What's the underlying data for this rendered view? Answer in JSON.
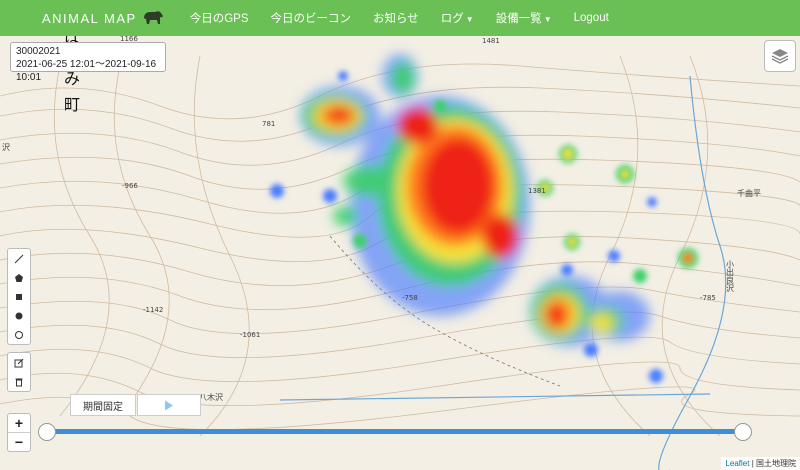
{
  "app": {
    "brand": "ANIMAL MAP"
  },
  "nav": {
    "items": [
      {
        "label": "今日のGPS"
      },
      {
        "label": "今日のビーコン"
      },
      {
        "label": "お知らせ"
      },
      {
        "label": "ログ",
        "dropdown": true
      },
      {
        "label": "設備一覧",
        "dropdown": true
      },
      {
        "label": "Logout"
      }
    ]
  },
  "info": {
    "device_id": "30002021",
    "period": "2021-06-25 12:01～2021-09-16 10:01"
  },
  "map_labels": {
    "town": [
      "は",
      "み",
      "町"
    ],
    "elevations": [
      "1166",
      "1481",
      "781",
      "-966",
      "1381",
      "-758",
      "-785",
      "-1142",
      "-1061"
    ],
    "places": [
      "千曲平",
      "小出良沢",
      "八木沢",
      "沢"
    ]
  },
  "controls": {
    "fix_period": "期間固定",
    "zoom_in": "+",
    "zoom_out": "−",
    "draw_tools": [
      "polyline-icon",
      "polygon-icon",
      "rectangle-icon",
      "circle-icon",
      "circlemarker-icon"
    ],
    "edit_tools": [
      "edit-icon",
      "delete-icon"
    ]
  },
  "slider": {
    "start": 0,
    "end": 1
  },
  "attribution": {
    "leaflet": "Leaflet",
    "sep": " | ",
    "source": "国土地理院"
  },
  "colors": {
    "nav": "#6abf55",
    "slider": "#3f8fd6",
    "contour": "#c8a98a"
  }
}
